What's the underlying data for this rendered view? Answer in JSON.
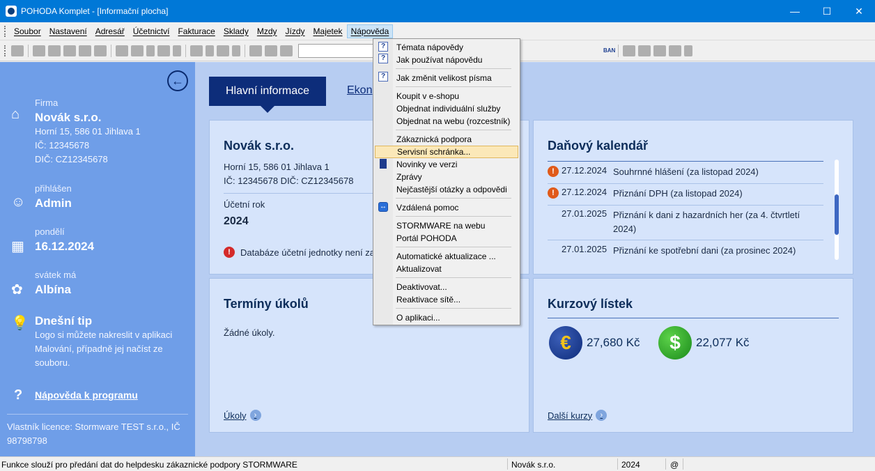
{
  "window": {
    "title": "POHODA Komplet - [Informační plocha]",
    "minimize": "—",
    "maximize": "☐",
    "close": "✕"
  },
  "menu": {
    "items": [
      "Soubor",
      "Nastavení",
      "Adresář",
      "Účetnictví",
      "Fakturace",
      "Sklady",
      "Mzdy",
      "Jízdy",
      "Majetek",
      "Nápověda"
    ],
    "active": "Nápověda"
  },
  "toolbar": {
    "iban_label": "BAN"
  },
  "left": {
    "firma_label": "Firma",
    "firma_name": "Novák s.r.o.",
    "firma_address": "Horní 15, 586 01 Jihlava 1",
    "firma_ic": "IČ: 12345678",
    "firma_dic": "DIČ: CZ12345678",
    "user_label": "přihlášen",
    "user_name": "Admin",
    "day_label": "pondělí",
    "date": "16.12.2024",
    "nameday_label": "svátek má",
    "nameday_name": "Albína",
    "tip_title": "Dnešní tip",
    "tip_text": "Logo si můžete nakreslit v aplikaci Malování, případně jej načíst ze souboru.",
    "help_link": "Nápověda k programu",
    "licence": "Vlastník licence: Stormware TEST s.r.o., IČ 98798798"
  },
  "tabs": {
    "active": "Hlavní informace",
    "other": "Ekon"
  },
  "company_card": {
    "title": "Novák s.r.o.",
    "address": "Horní 15, 586 01 Jihlava 1",
    "ids": "IČ: 12345678  DIČ: CZ12345678",
    "year_label": "Účetní rok",
    "year": "2024",
    "warning": "Databáze účetní jednotky není za"
  },
  "tax_card": {
    "title": "Daňový kalendář",
    "rows": [
      {
        "date": "27.12.2024",
        "text": "Souhrnné hlášení (za listopad 2024)",
        "warn": true
      },
      {
        "date": "27.12.2024",
        "text": "Přiznání DPH (za listopad 2024)",
        "warn": true
      },
      {
        "date": "27.01.2025",
        "text": "Přiznání k dani z hazardních her (za 4. čtvrtletí 2024)",
        "warn": false
      },
      {
        "date": "27.01.2025",
        "text": "Přiznání ke spotřební dani (za prosinec 2024)",
        "warn": false
      }
    ]
  },
  "tasks_card": {
    "title": "Termíny úkolů",
    "empty": "Žádné úkoly.",
    "link": "Úkoly"
  },
  "rates_card": {
    "title": "Kurzový lístek",
    "eur_symbol": "€",
    "eur_rate": "27,680 Kč",
    "usd_symbol": "$",
    "usd_rate": "22,077 Kč",
    "link": "Další kurzy"
  },
  "dropdown": {
    "items": [
      "Témata nápovědy",
      "Jak používat nápovědu",
      "Jak změnit velikost písma",
      "Koupit v e-shopu",
      "Objednat individuální služby",
      "Objednat na webu (rozcestník)",
      "Zákaznická podpora",
      "Servisní schránka...",
      "Novinky ve verzi",
      "Zprávy",
      "Nejčastější otázky a odpovědi",
      "Vzdálená pomoc",
      "STORMWARE na webu",
      "Portál POHODA",
      "Automatické aktualizace ...",
      "Aktualizovat",
      "Deaktivovat...",
      "Reaktivace sítě...",
      "O aplikaci..."
    ],
    "highlighted": "Servisní schránka..."
  },
  "status": {
    "message": "Funkce slouží pro předání dat do helpdesku zákaznické podpory STORMWARE",
    "company": "Novák s.r.o.",
    "year": "2024",
    "at": "@"
  }
}
